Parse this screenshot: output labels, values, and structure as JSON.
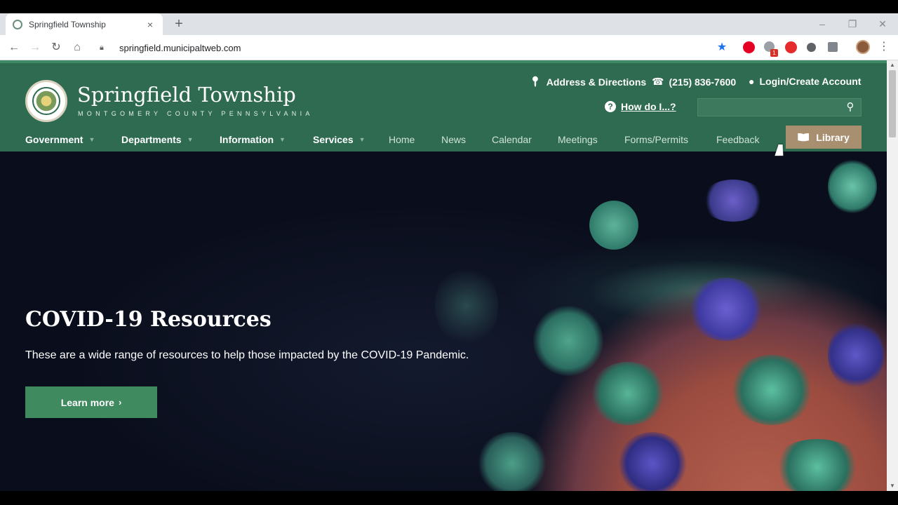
{
  "browser": {
    "tab_title": "Springfield Township",
    "tab_close": "×",
    "new_tab": "+",
    "url": "springfield.municipaltweb.com",
    "extension_badge": "1"
  },
  "site": {
    "name": "Springfield Township",
    "subtitle": "MONTGOMERY COUNTY PENNSYLVANIA",
    "utility": {
      "address": "Address & Directions",
      "phone": "(215) 836-7600",
      "login": "Login/Create Account",
      "how_do_i": "How do I...?"
    },
    "search": {
      "placeholder": ""
    },
    "nav": [
      {
        "label": "Government"
      },
      {
        "label": "Departments"
      },
      {
        "label": "Information"
      },
      {
        "label": "Services"
      },
      {
        "label": "Home"
      },
      {
        "label": "News"
      },
      {
        "label": "Calendar"
      },
      {
        "label": "Meetings"
      },
      {
        "label": "Forms/Permits"
      },
      {
        "label": "Feedback"
      }
    ],
    "library": "Library",
    "colors": {
      "header": "#2f6b50",
      "library": "#a88f70",
      "button": "#3f8a5f"
    }
  },
  "hero": {
    "title": "COVID-19 Resources",
    "description": "These are a wide range of resources to help those impacted by the COVID-19 Pandemic.",
    "button": "Learn more"
  },
  "icons": {
    "tab_favicon": "township-seal-icon",
    "back": "back-arrow-icon",
    "forward": "forward-arrow-icon",
    "reload": "reload-icon",
    "home": "home-icon",
    "lock": "lock-icon",
    "star": "star-icon",
    "address": "map-pin-icon",
    "phone": "phone-icon",
    "login": "user-icon",
    "how_do_i": "question-icon",
    "search": "search-icon",
    "library": "book-icon"
  }
}
